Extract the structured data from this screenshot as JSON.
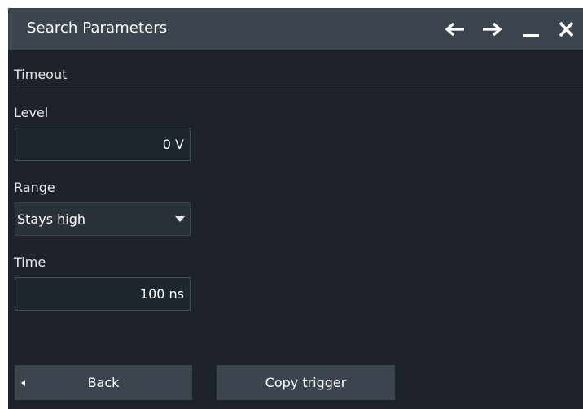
{
  "dialog": {
    "title": "Search Parameters",
    "controls": {
      "back_icon": "arrow-left-icon",
      "forward_icon": "arrow-right-icon",
      "minimize_icon": "minimize-icon",
      "close_icon": "close-icon"
    }
  },
  "section": {
    "title": "Timeout"
  },
  "fields": {
    "level": {
      "label": "Level",
      "value": "0 V"
    },
    "range": {
      "label": "Range",
      "value": "Stays high"
    },
    "time": {
      "label": "Time",
      "value": "100 ns"
    }
  },
  "buttons": {
    "back_label": "Back",
    "copy_trigger_label": "Copy trigger"
  },
  "colors": {
    "dialog_background": "#1d2329",
    "titlebar_background": "#3c454d",
    "button_background": "#3c454d",
    "text": "#e6eaee"
  }
}
